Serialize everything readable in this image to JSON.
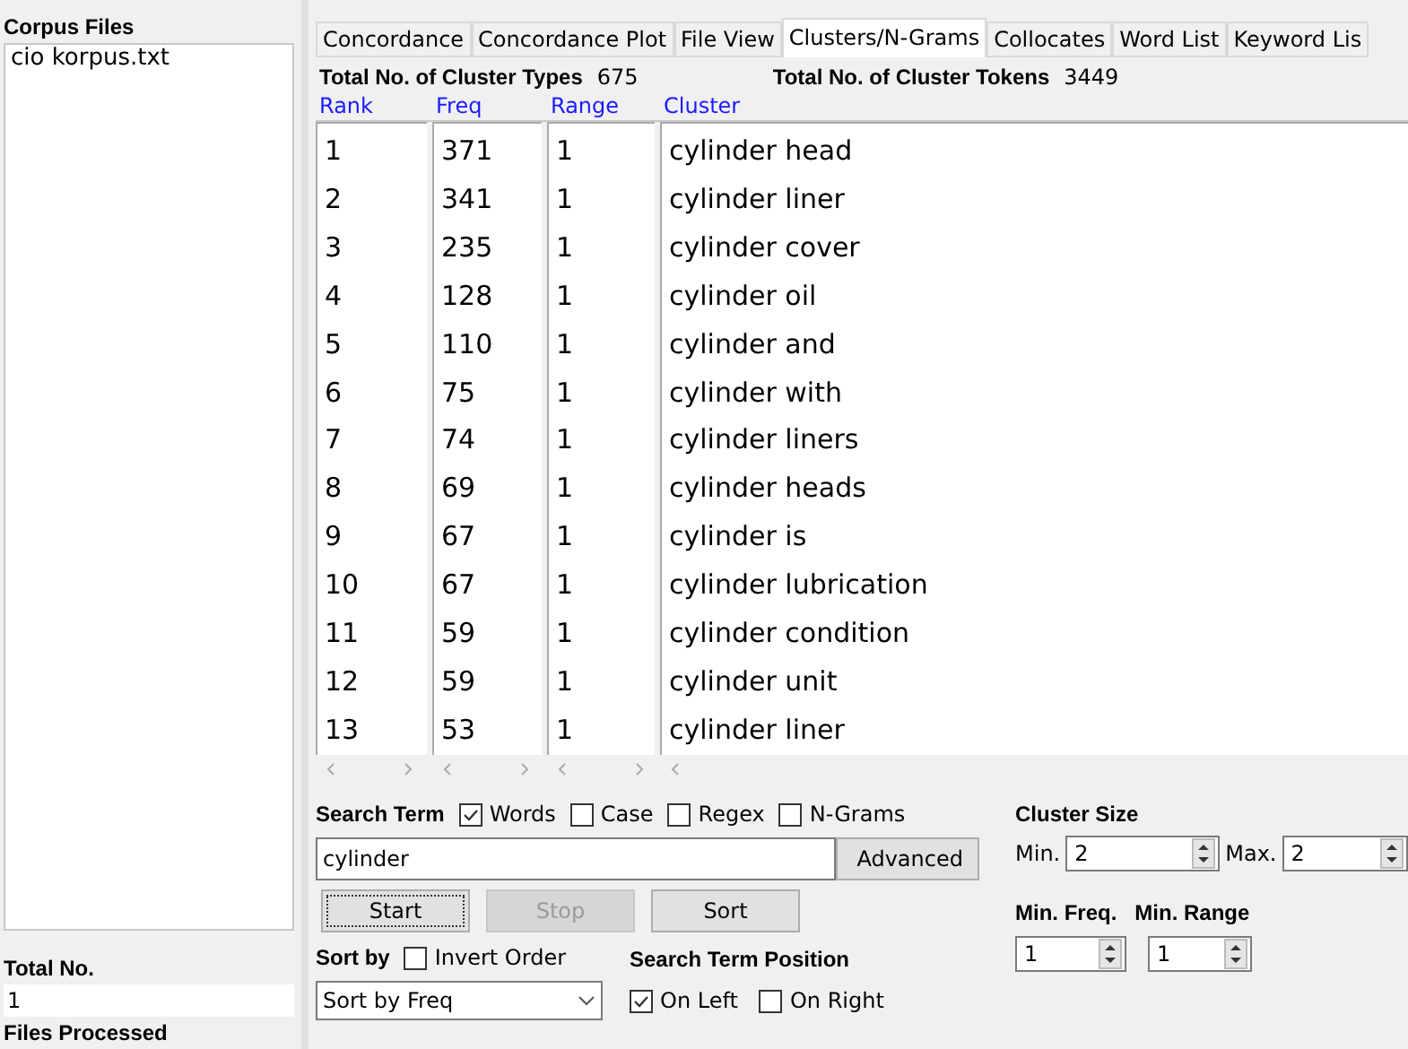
{
  "sidebar": {
    "title": "Corpus Files",
    "files": [
      "cio korpus.txt"
    ],
    "total_label": "Total No.",
    "total_value": "1",
    "processed_label": "Files Processed"
  },
  "tabs": [
    {
      "label": "Concordance",
      "selected": false
    },
    {
      "label": "Concordance Plot",
      "selected": false
    },
    {
      "label": "File View",
      "selected": false
    },
    {
      "label": "Clusters/N-Grams",
      "selected": true
    },
    {
      "label": "Collocates",
      "selected": false
    },
    {
      "label": "Word List",
      "selected": false
    },
    {
      "label": "Keyword Lis",
      "selected": false
    }
  ],
  "summary": {
    "types_label": "Total No. of Cluster Types",
    "types_value": "675",
    "tokens_label": "Total No. of Cluster Tokens",
    "tokens_value": "3449"
  },
  "table": {
    "columns": [
      "Rank",
      "Freq",
      "Range",
      "Cluster"
    ],
    "rows": [
      [
        "1",
        "371",
        "1",
        "cylinder head"
      ],
      [
        "2",
        "341",
        "1",
        "cylinder liner"
      ],
      [
        "3",
        "235",
        "1",
        "cylinder cover"
      ],
      [
        "4",
        "128",
        "1",
        "cylinder oil"
      ],
      [
        "5",
        "110",
        "1",
        "cylinder and"
      ],
      [
        "6",
        "75",
        "1",
        "cylinder with"
      ],
      [
        "7",
        "74",
        "1",
        "cylinder liners"
      ],
      [
        "8",
        "69",
        "1",
        "cylinder heads"
      ],
      [
        "9",
        "67",
        "1",
        "cylinder is"
      ],
      [
        "10",
        "67",
        "1",
        "cylinder lubrication"
      ],
      [
        "11",
        "59",
        "1",
        "cylinder condition"
      ],
      [
        "12",
        "59",
        "1",
        "cylinder unit"
      ],
      [
        "13",
        "53",
        "1",
        "cylinder  liner"
      ]
    ]
  },
  "search": {
    "label": "Search Term",
    "options": [
      {
        "label": "Words",
        "checked": true
      },
      {
        "label": "Case",
        "checked": false
      },
      {
        "label": "Regex",
        "checked": false
      },
      {
        "label": "N-Grams",
        "checked": false
      }
    ],
    "value": "cylinder",
    "advanced": "Advanced"
  },
  "buttons": [
    {
      "label": "Start",
      "disabled": false
    },
    {
      "label": "Stop",
      "disabled": true
    },
    {
      "label": "Sort",
      "disabled": false
    }
  ],
  "sort": {
    "label": "Sort by",
    "invert": {
      "label": "Invert Order",
      "checked": false
    },
    "value": "Sort by Freq"
  },
  "position": {
    "label": "Search Term Position",
    "options": [
      {
        "label": "On Left",
        "checked": true
      },
      {
        "label": "On Right",
        "checked": false
      }
    ]
  },
  "cluster_size": {
    "label": "Cluster Size",
    "min_label": "Min.",
    "min": "2",
    "max_label": "Max.",
    "max": "2"
  },
  "thresholds": {
    "freq_label": "Min. Freq.",
    "freq": "1",
    "range_label": "Min. Range",
    "range": "1"
  }
}
